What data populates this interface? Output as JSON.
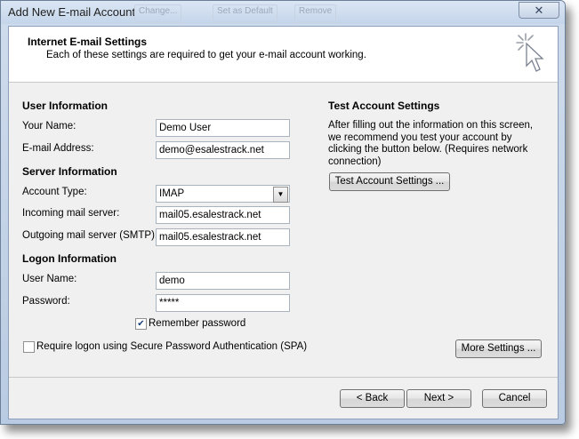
{
  "window": {
    "title": "Add New E-mail Account",
    "background_labels": [
      "Change...",
      "Set as Default",
      "Remove"
    ],
    "close_symbol": "✕"
  },
  "header": {
    "title": "Internet E-mail Settings",
    "subtitle": "Each of these settings are required to get your e-mail account working."
  },
  "user_info": {
    "section": "User Information",
    "name_label": "Your Name:",
    "name_value": "Demo User",
    "email_label": "E-mail Address:",
    "email_value": "demo@esalestrack.net"
  },
  "server_info": {
    "section": "Server Information",
    "account_type_label": "Account Type:",
    "account_type_value": "IMAP",
    "incoming_label": "Incoming mail server:",
    "incoming_value": "mail05.esalestrack.net",
    "outgoing_label": "Outgoing mail server (SMTP):",
    "outgoing_value": "mail05.esalestrack.net"
  },
  "logon_info": {
    "section": "Logon Information",
    "username_label": "User Name:",
    "username_value": "demo",
    "password_label": "Password:",
    "password_value": "*****",
    "remember_label": "Remember password",
    "remember_checked": true,
    "spa_label": "Require logon using Secure Password Authentication (SPA)",
    "spa_checked": false
  },
  "test_settings": {
    "section": "Test Account Settings",
    "description": "After filling out the information on this screen, we recommend you test your account by clicking the button below. (Requires network connection)",
    "button": "Test Account Settings ..."
  },
  "buttons": {
    "more_settings": "More Settings ...",
    "back": "< Back",
    "next": "Next >",
    "cancel": "Cancel"
  },
  "icons": {
    "wizard": "sparkle-cursor-icon",
    "dropdown": "chevron-down-icon",
    "check": "checkmark-icon"
  },
  "colors": {
    "frame": "#b9cbe2",
    "client": "#f0f0f0",
    "header": "#ffffff"
  }
}
